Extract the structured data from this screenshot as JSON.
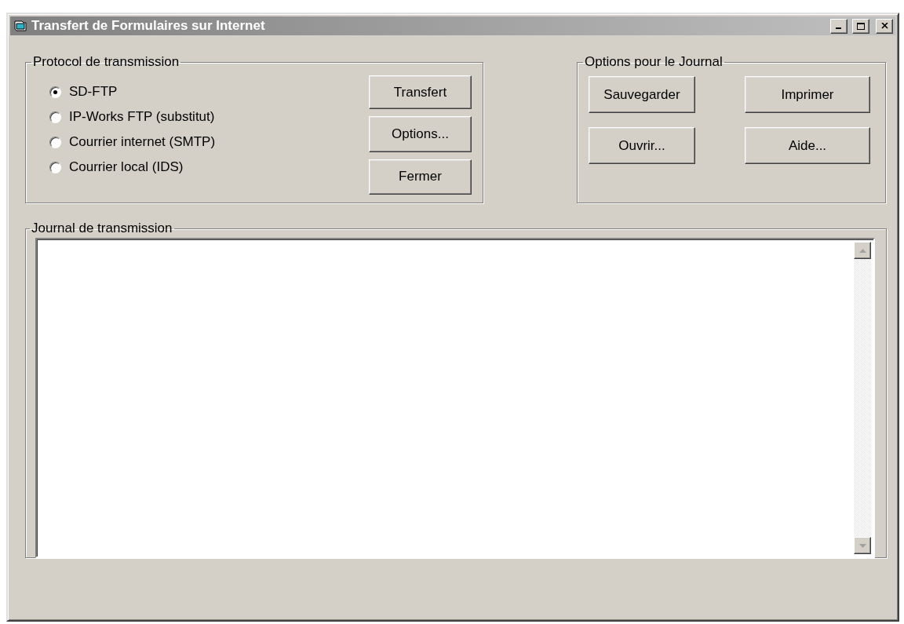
{
  "window": {
    "title": "Transfert de Formulaires sur Internet"
  },
  "protocol_group": {
    "label": "Protocol de transmission",
    "options": [
      {
        "label": "SD-FTP",
        "selected": true
      },
      {
        "label": "IP-Works FTP (substitut)",
        "selected": false
      },
      {
        "label": "Courrier internet (SMTP)",
        "selected": false
      },
      {
        "label": "Courrier local (IDS)",
        "selected": false
      }
    ],
    "buttons": [
      "Transfert",
      "Options...",
      "Fermer"
    ]
  },
  "journal_options_group": {
    "label": "Options pour le Journal",
    "buttons": [
      "Sauvegarder",
      "Imprimer",
      "Ouvrir...",
      "Aide..."
    ]
  },
  "journal": {
    "label": "Journal de transmission"
  }
}
